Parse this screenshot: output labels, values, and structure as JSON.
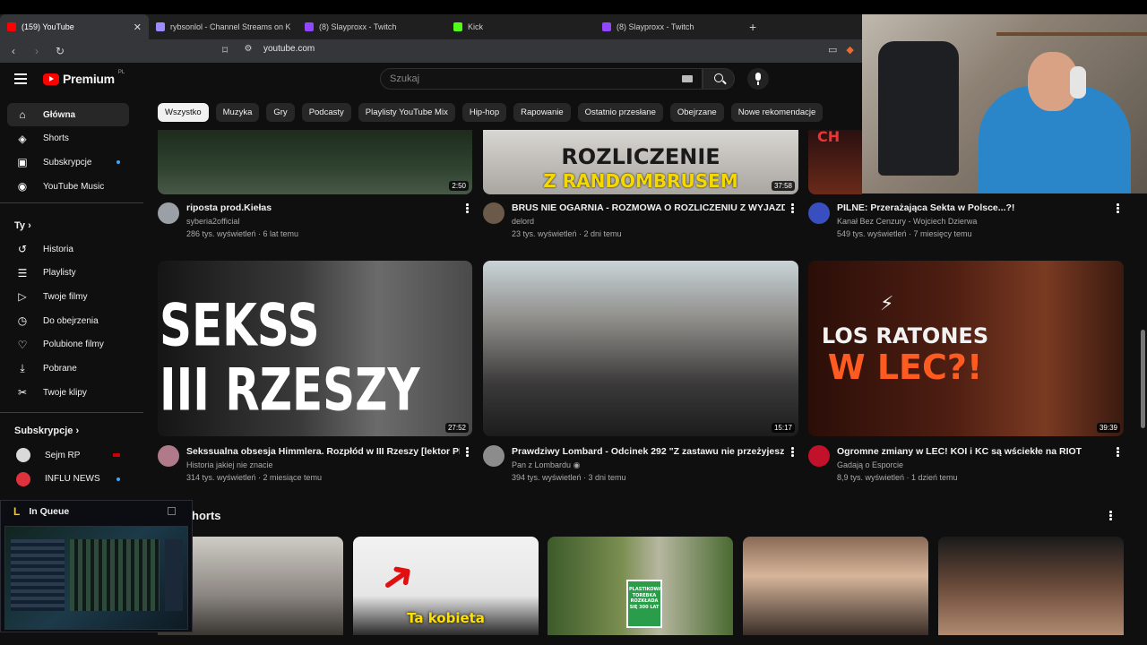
{
  "browser": {
    "tabs": [
      {
        "title": "(159) YouTube",
        "color": "#ff0000",
        "active": true
      },
      {
        "title": "rybsonlol - Channel Streams on Kick",
        "color": "#9d8cff",
        "active": false
      },
      {
        "title": "(8) Slayproxx - Twitch",
        "color": "#9146ff",
        "active": false
      },
      {
        "title": "Kick",
        "color": "#53fc18",
        "active": false
      },
      {
        "title": "(8) Slayproxx - Twitch",
        "color": "#9146ff",
        "active": false
      }
    ],
    "close_glyph": "✕",
    "new_tab_glyph": "+",
    "url": "youtube.com"
  },
  "header": {
    "logo_text": "Premium",
    "logo_region": "PL",
    "search_placeholder": "Szukaj"
  },
  "chips": [
    "Wszystko",
    "Muzyka",
    "Gry",
    "Podcasty",
    "Playlisty YouTube Mix",
    "Hip-hop",
    "Rapowanie",
    "Ostatnio przesłane",
    "Obejrzane",
    "Nowe rekomendacje"
  ],
  "sidebar": {
    "main": [
      {
        "label": "Główna",
        "icon": "home-icon",
        "glyph": "⌂"
      },
      {
        "label": "Shorts",
        "icon": "shorts-icon",
        "glyph": "◈"
      },
      {
        "label": "Subskrypcje",
        "icon": "subscriptions-icon",
        "glyph": "▣"
      },
      {
        "label": "YouTube Music",
        "icon": "music-icon",
        "glyph": "◉"
      }
    ],
    "you_heading": "Ty",
    "you": [
      {
        "label": "Historia",
        "icon": "history-icon",
        "glyph": "↺"
      },
      {
        "label": "Playlisty",
        "icon": "playlists-icon",
        "glyph": "☰"
      },
      {
        "label": "Twoje filmy",
        "icon": "your-videos-icon",
        "glyph": "▷"
      },
      {
        "label": "Do obejrzenia",
        "icon": "watch-later-icon",
        "glyph": "◷"
      },
      {
        "label": "Polubione filmy",
        "icon": "liked-icon",
        "glyph": "♡"
      },
      {
        "label": "Pobrane",
        "icon": "download-icon",
        "glyph": "⤓"
      },
      {
        "label": "Twoje klipy",
        "icon": "clips-icon",
        "glyph": "✂"
      }
    ],
    "subs_heading": "Subskrypcje",
    "subs": [
      {
        "label": "Sejm RP",
        "color": "#d9d9d9"
      },
      {
        "label": "INFLU NEWS",
        "color": "#e0323c"
      }
    ]
  },
  "videos": [
    {
      "title": "riposta prod.Kiełas",
      "channel": "syberia2official",
      "meta": "286 tys. wyświetleń · 6 lat temu",
      "duration": "2:50"
    },
    {
      "title": "BRUS NIE OGARNIA - ROZMOWA  O ROZLICZENIU Z WYJAZDU",
      "channel": "delord",
      "meta": "23 tys. wyświetleń · 2 dni temu",
      "duration": "37:58",
      "thumb_text_1": "ROZLICZENIE",
      "thumb_text_2": "Z RANDOMBRUSEM"
    },
    {
      "title": "PILNE: Przerażająca Sekta w Polsce...?!",
      "channel": "Kanał Bez Cenzury - Wojciech Dzierwa",
      "meta": "549 tys. wyświetleń · 7 miesięcy temu",
      "duration": ""
    },
    {
      "title": "Sekssualna obsesja Himmlera. Rozpłód w III Rzeszy [lektor PL]",
      "channel": "Historia jakiej nie znacie",
      "meta": "314 tys. wyświetleń · 2 miesiące temu",
      "duration": "27:52",
      "thumb_text_1": "SEKSS",
      "thumb_text_2": "III RZESZY"
    },
    {
      "title": "Prawdziwy Lombard - Odcinek 292 \"Z zastawu nie przeżyjesz\"",
      "channel": "Pan z Lombardu",
      "meta": "394 tys. wyświetleń · 3 dni temu",
      "duration": "15:17"
    },
    {
      "title": "Ogromne zmiany w LEC! KOI i KC są wściekłe na RIOT",
      "channel": "Gadają o Esporcie",
      "meta": "8,9 tys. wyświetleń · 1 dzień temu",
      "duration": "39:39",
      "thumb_text_1": "LOS RATONES",
      "thumb_text_2": "W LEC?!"
    }
  ],
  "shorts": {
    "heading": "horts",
    "items": [
      {
        "caption": ""
      },
      {
        "caption": "Ta kobieta"
      },
      {
        "caption": "PLASTIKOWA TOREBKA ROZKŁADA SIĘ 300 LAT"
      },
      {
        "caption": ""
      },
      {
        "caption": ""
      }
    ]
  },
  "queue_overlay": {
    "title": "In Queue",
    "logo": "L"
  },
  "colors": {
    "background": "#0f0f0f",
    "chip": "#272727",
    "youtube_red": "#ff0000",
    "accent_blue": "#3ea6ff"
  }
}
